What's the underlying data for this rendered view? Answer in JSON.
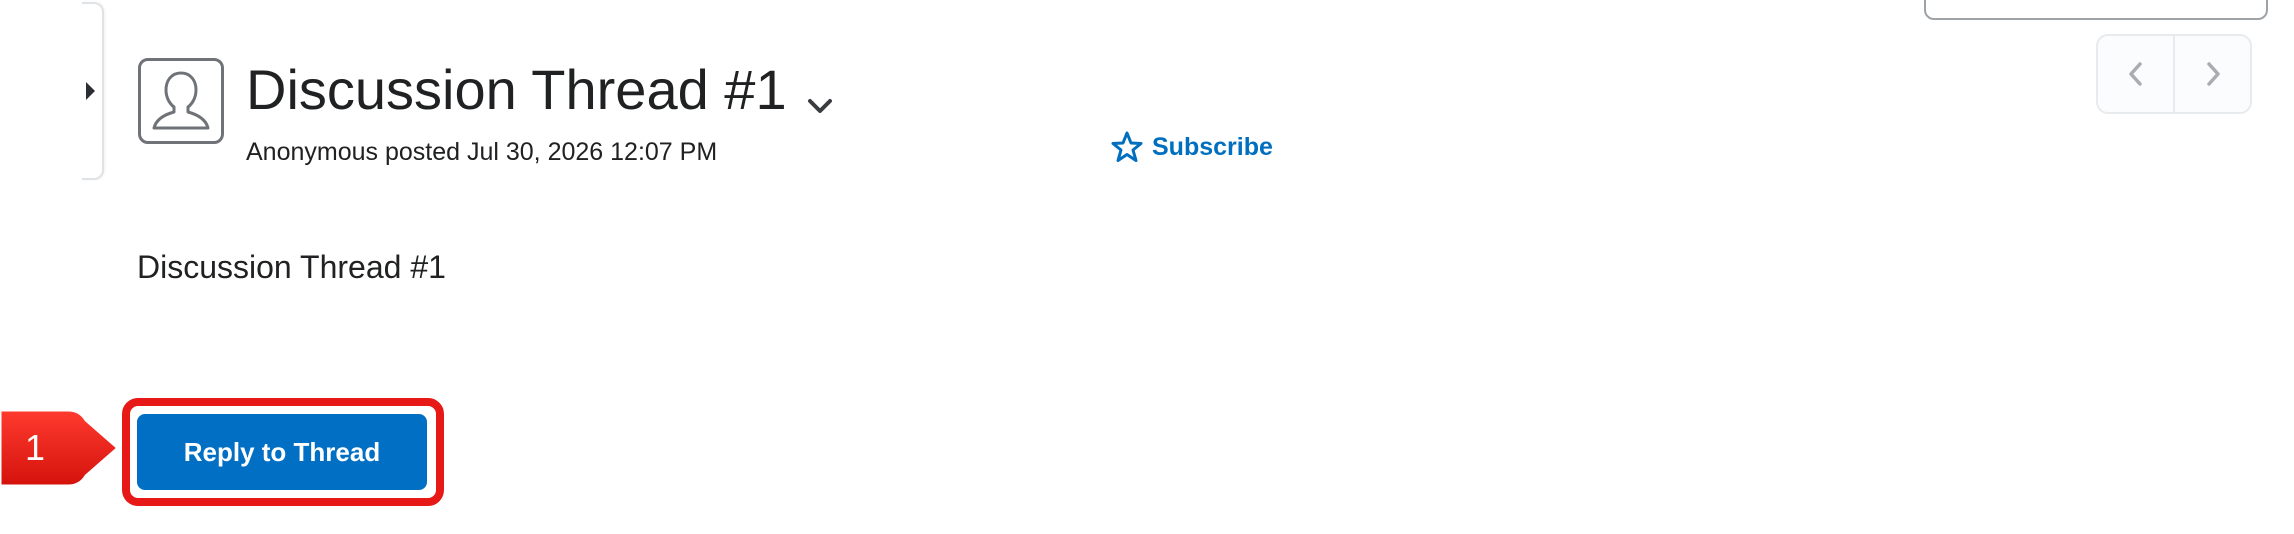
{
  "thread": {
    "title": "Discussion Thread #1",
    "meta": "Anonymous posted Jul 30, 2026 12:07 PM",
    "body": "Discussion Thread #1"
  },
  "actions": {
    "subscribe_label": "Subscribe",
    "reply_label": "Reply to Thread"
  },
  "annotation": {
    "step_number": "1"
  },
  "colors": {
    "accent": "#006fc4",
    "link": "#006fbf",
    "highlight": "#e61917",
    "text": "#202122"
  },
  "icons": {
    "avatar": "user-placeholder-icon",
    "title_menu": "chevron-down-icon",
    "subscribe": "star-outline-icon",
    "prev": "chevron-left-icon",
    "next": "chevron-right-icon",
    "side_panel": "caret-right-icon"
  }
}
